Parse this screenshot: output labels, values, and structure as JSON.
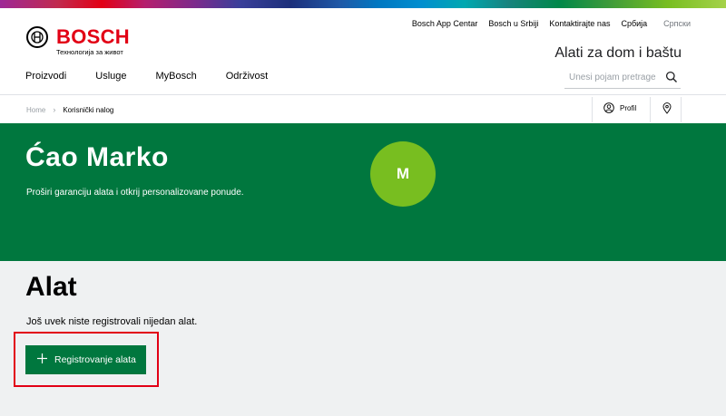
{
  "brand": {
    "name": "BOSCH",
    "tagline": "Технологија за живот",
    "color": "#e20015"
  },
  "top_links": [
    "Bosch App Centar",
    "Bosch u Srbiji",
    "Kontaktirajte nas",
    "Србија"
  ],
  "language": "Српски",
  "category_title": "Alati za dom i baštu",
  "nav": [
    "Proizvodi",
    "Usluge",
    "MyBosch",
    "Održivost"
  ],
  "search": {
    "placeholder": "Unesi pojam pretrage",
    "icon": "search-icon"
  },
  "breadcrumb": {
    "home": "Home",
    "current": "Korisnički nalog"
  },
  "profile_label": "Profil",
  "hero": {
    "greeting": "Ćao Marko",
    "subtitle": "Proširi garanciju alata i otkrij personalizovane ponude.",
    "avatar_initial": "M",
    "background": "#00773e",
    "avatar_color": "#78be20"
  },
  "tools": {
    "title": "Alat",
    "empty_message": "Još uvek niste registrovali nijedan alat.",
    "register_button": "Registrovanje alata",
    "highlight_color": "#e20015"
  }
}
